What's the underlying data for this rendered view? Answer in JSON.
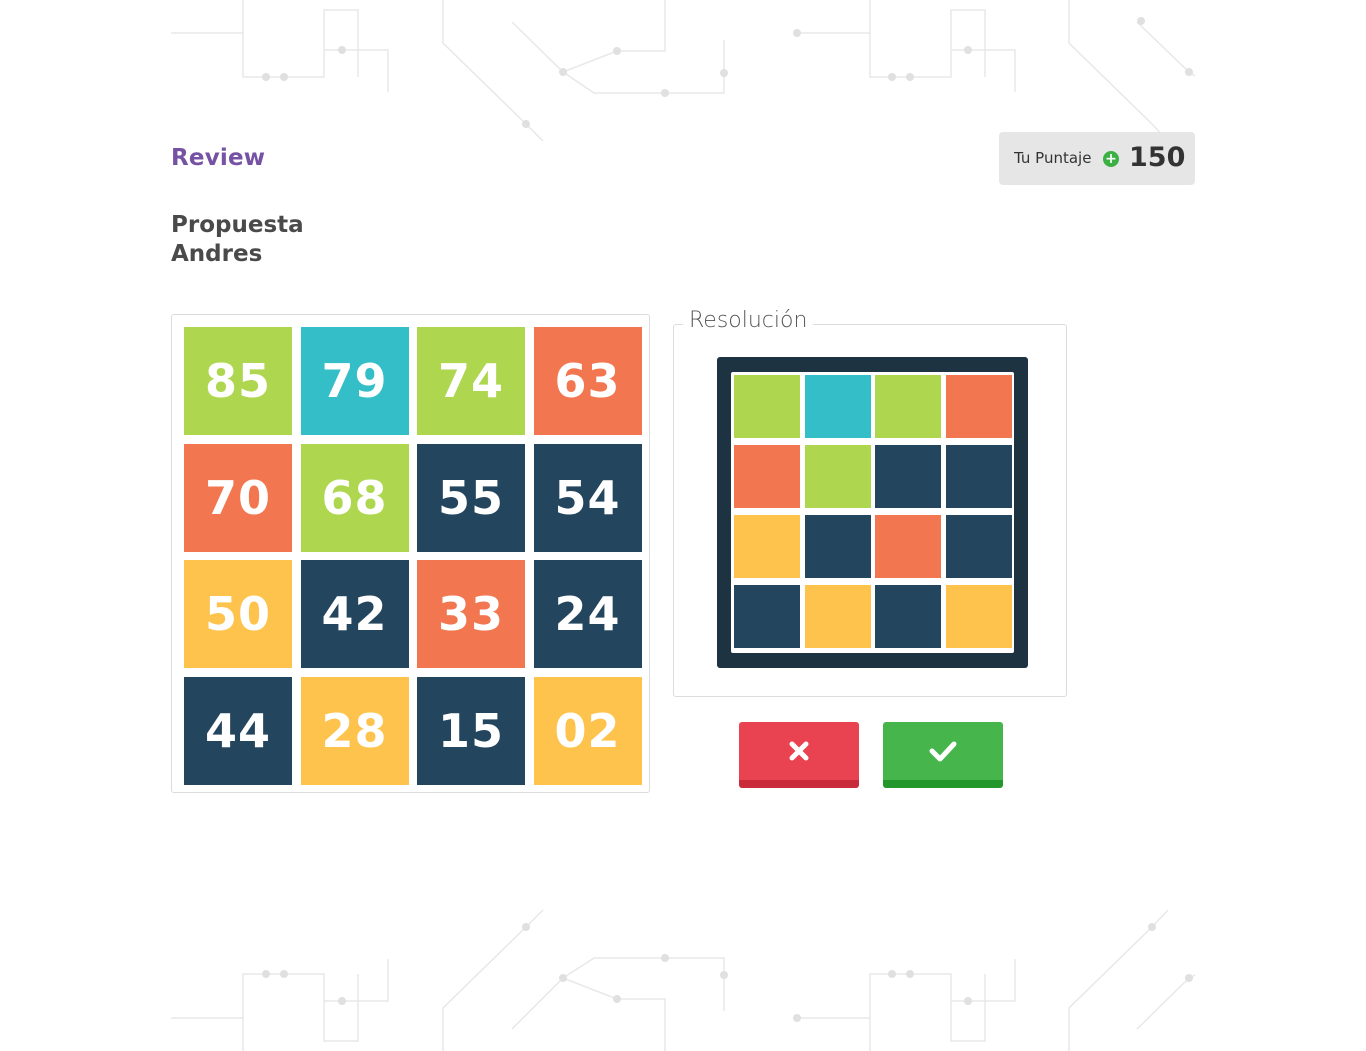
{
  "header": {
    "review_title": "Review",
    "score_label": "Tu Puntaje",
    "score_icon": "plus-circle-icon",
    "score_value": "150"
  },
  "proposal": {
    "title_line1": "Propuesta",
    "title_line2": "Andres",
    "tiles": [
      {
        "value": "85",
        "color": "#aed64f"
      },
      {
        "value": "79",
        "color": "#33bec8"
      },
      {
        "value": "74",
        "color": "#aed64f"
      },
      {
        "value": "63",
        "color": "#f2764f"
      },
      {
        "value": "70",
        "color": "#f2764f"
      },
      {
        "value": "68",
        "color": "#aed64f"
      },
      {
        "value": "55",
        "color": "#23455d"
      },
      {
        "value": "54",
        "color": "#23455d"
      },
      {
        "value": "50",
        "color": "#fdc34d"
      },
      {
        "value": "42",
        "color": "#23455d"
      },
      {
        "value": "33",
        "color": "#f2764f"
      },
      {
        "value": "24",
        "color": "#23455d"
      },
      {
        "value": "44",
        "color": "#23455d"
      },
      {
        "value": "28",
        "color": "#fdc34d"
      },
      {
        "value": "15",
        "color": "#23455d"
      },
      {
        "value": "02",
        "color": "#fdc34d"
      }
    ]
  },
  "resolution": {
    "legend": "Resolución",
    "cells": [
      "#aed64f",
      "#33bec8",
      "#aed64f",
      "#f2764f",
      "#f2764f",
      "#aed64f",
      "#23455d",
      "#23455d",
      "#fdc34d",
      "#23455d",
      "#f2764f",
      "#23455d",
      "#23455d",
      "#fdc34d",
      "#23455d",
      "#fdc34d"
    ]
  },
  "actions": {
    "reject_icon": "close-icon",
    "accept_icon": "checkmark-icon",
    "reject_color": "#e94250",
    "accept_color": "#46b54b"
  },
  "colors": {
    "accent_purple": "#7552a3",
    "green": "#aed64f",
    "cyan": "#33bec8",
    "orange": "#f2764f",
    "navy": "#23455d",
    "yellow": "#fdc34d"
  }
}
